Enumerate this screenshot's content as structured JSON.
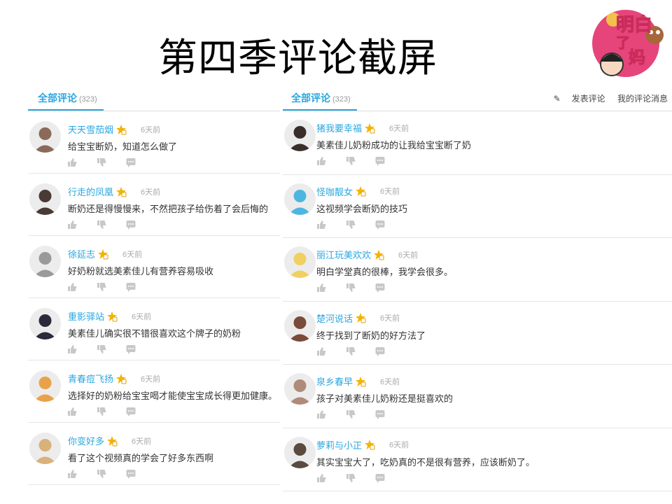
{
  "slide": {
    "title": "第四季评论截屏"
  },
  "logo": {
    "text": "明白了妈"
  },
  "left": {
    "tab_label": "全部评论",
    "tab_count": "(323)",
    "comments": [
      {
        "user": "天天雪茄烟",
        "time": "6天前",
        "text": "给宝宝断奶，知道怎么做了",
        "avatar_color": "#8b6a5a"
      },
      {
        "user": "行走的凤凰",
        "time": "6天前",
        "text": "断奶还是得慢慢来，不然把孩子给伤着了会后悔的",
        "avatar_color": "#4a3a35"
      },
      {
        "user": "徐延志",
        "time": "6天前",
        "text": "好奶粉就选美素佳儿有营养容易吸收",
        "avatar_color": "#9a9a9a"
      },
      {
        "user": "重影驿站",
        "time": "6天前",
        "text": "美素佳儿确实很不错很喜欢这个牌子的奶粉",
        "avatar_color": "#2a2a3a"
      },
      {
        "user": "青春痘飞扬",
        "time": "6天前",
        "text": "选择好的奶粉给宝宝喝才能使宝宝成长得更加健康。",
        "avatar_color": "#e8a24a"
      },
      {
        "user": "你变好多",
        "time": "6天前",
        "text": "看了这个视频真的学会了好多东西啊",
        "avatar_color": "#d9b27a"
      }
    ]
  },
  "right": {
    "tab_label": "全部评论",
    "tab_count": "(323)",
    "post_comment": "发表评论",
    "my_messages": "我的评论消息",
    "comments": [
      {
        "user": "猪我要幸福",
        "time": "6天前",
        "text": "美素佳儿奶粉成功的让我给宝宝断了奶",
        "avatar_color": "#3a2e2a"
      },
      {
        "user": "怪咖靓女",
        "time": "6天前",
        "text": "这视频学会断奶的技巧",
        "avatar_color": "#4cb6e0"
      },
      {
        "user": "丽江玩美欢欢",
        "time": "6天前",
        "text": "明白学堂真的很棒，我学会很多。",
        "avatar_color": "#f0d060"
      },
      {
        "user": "楚河说话",
        "time": "6天前",
        "text": "终于找到了断奶的好方法了",
        "avatar_color": "#7a4a3a"
      },
      {
        "user": "泉乡春早",
        "time": "6天前",
        "text": "孩子对美素佳儿奶粉还是挺喜欢的",
        "avatar_color": "#b08a7a"
      },
      {
        "user": "萝莉与小正",
        "time": "6天前",
        "text": "其实宝宝大了，吃奶真的不是很有营养，应该断奶了。",
        "avatar_color": "#5a4a40"
      }
    ]
  }
}
